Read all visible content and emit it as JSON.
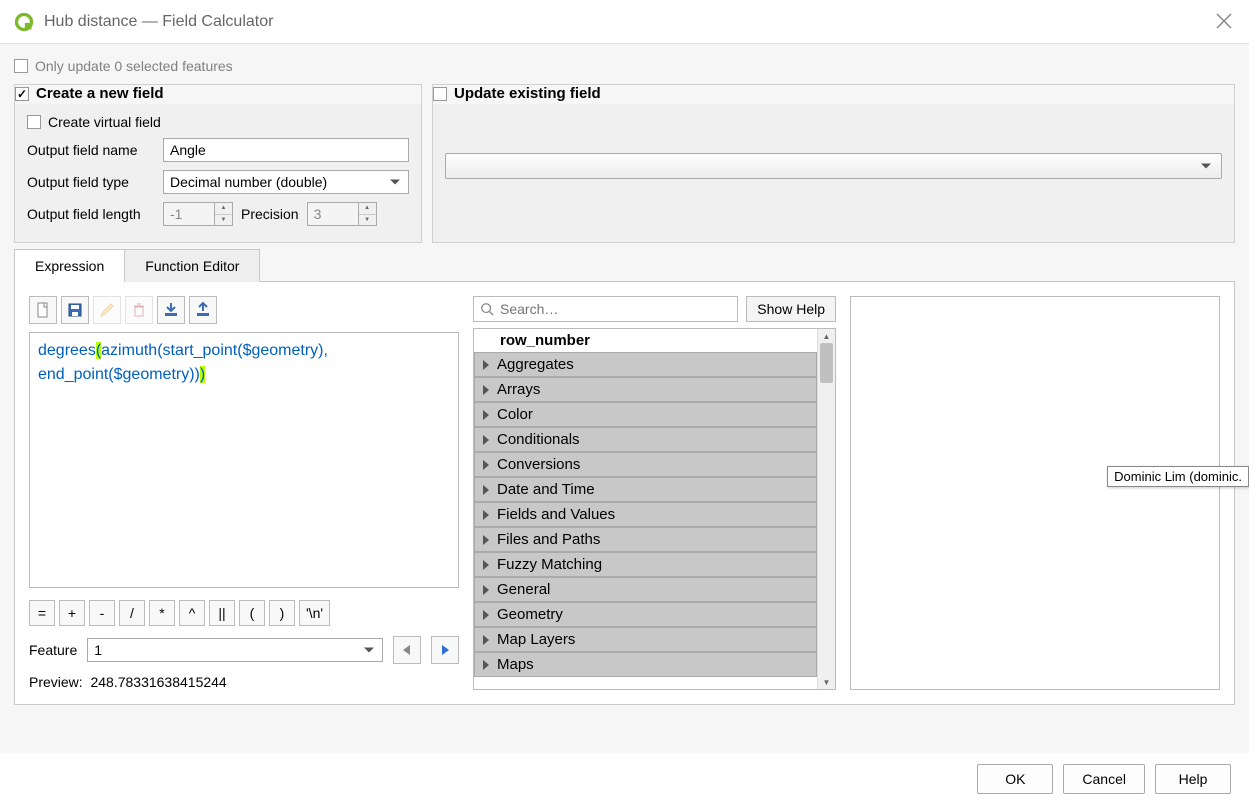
{
  "window": {
    "title": "Hub distance — Field Calculator"
  },
  "top": {
    "only_update_label": "Only update 0 selected features",
    "create_new_label": "Create a new field",
    "update_existing_label": "Update existing field"
  },
  "left_panel": {
    "virtual_label": "Create virtual field",
    "name_label": "Output field name",
    "name_value": "Angle",
    "type_label": "Output field type",
    "type_value": "Decimal number (double)",
    "length_label": "Output field length",
    "length_value": "-1",
    "precision_label": "Precision",
    "precision_value": "3"
  },
  "tabs": {
    "expression": "Expression",
    "func_editor": "Function Editor"
  },
  "expression_tokens": {
    "t1": "degrees",
    "t2": "(",
    "t3": "azimuth",
    "t4": "(",
    "t5": "start_point",
    "t6": "(",
    "t7": "$geometry",
    "t8": ")",
    "t9": ", ",
    "t10": "end_point",
    "t11": "(",
    "t12": "$geometry",
    "t13": ")",
    "t14": ")",
    "t15": ")"
  },
  "ops": [
    "=",
    "+",
    "-",
    "/",
    "*",
    "^",
    "||",
    "(",
    ")",
    "'\\n'"
  ],
  "feature": {
    "label": "Feature",
    "value": "1"
  },
  "preview": {
    "label": "Preview:",
    "value": "248.78331638415244"
  },
  "search": {
    "placeholder": "Search…",
    "show_help": "Show Help"
  },
  "tree": {
    "first": "row_number",
    "items": [
      "Aggregates",
      "Arrays",
      "Color",
      "Conditionals",
      "Conversions",
      "Date and Time",
      "Fields and Values",
      "Files and Paths",
      "Fuzzy Matching",
      "General",
      "Geometry",
      "Map Layers",
      "Maps"
    ]
  },
  "footer": {
    "ok": "OK",
    "cancel": "Cancel",
    "help": "Help"
  },
  "tooltip": "Dominic Lim (dominic."
}
